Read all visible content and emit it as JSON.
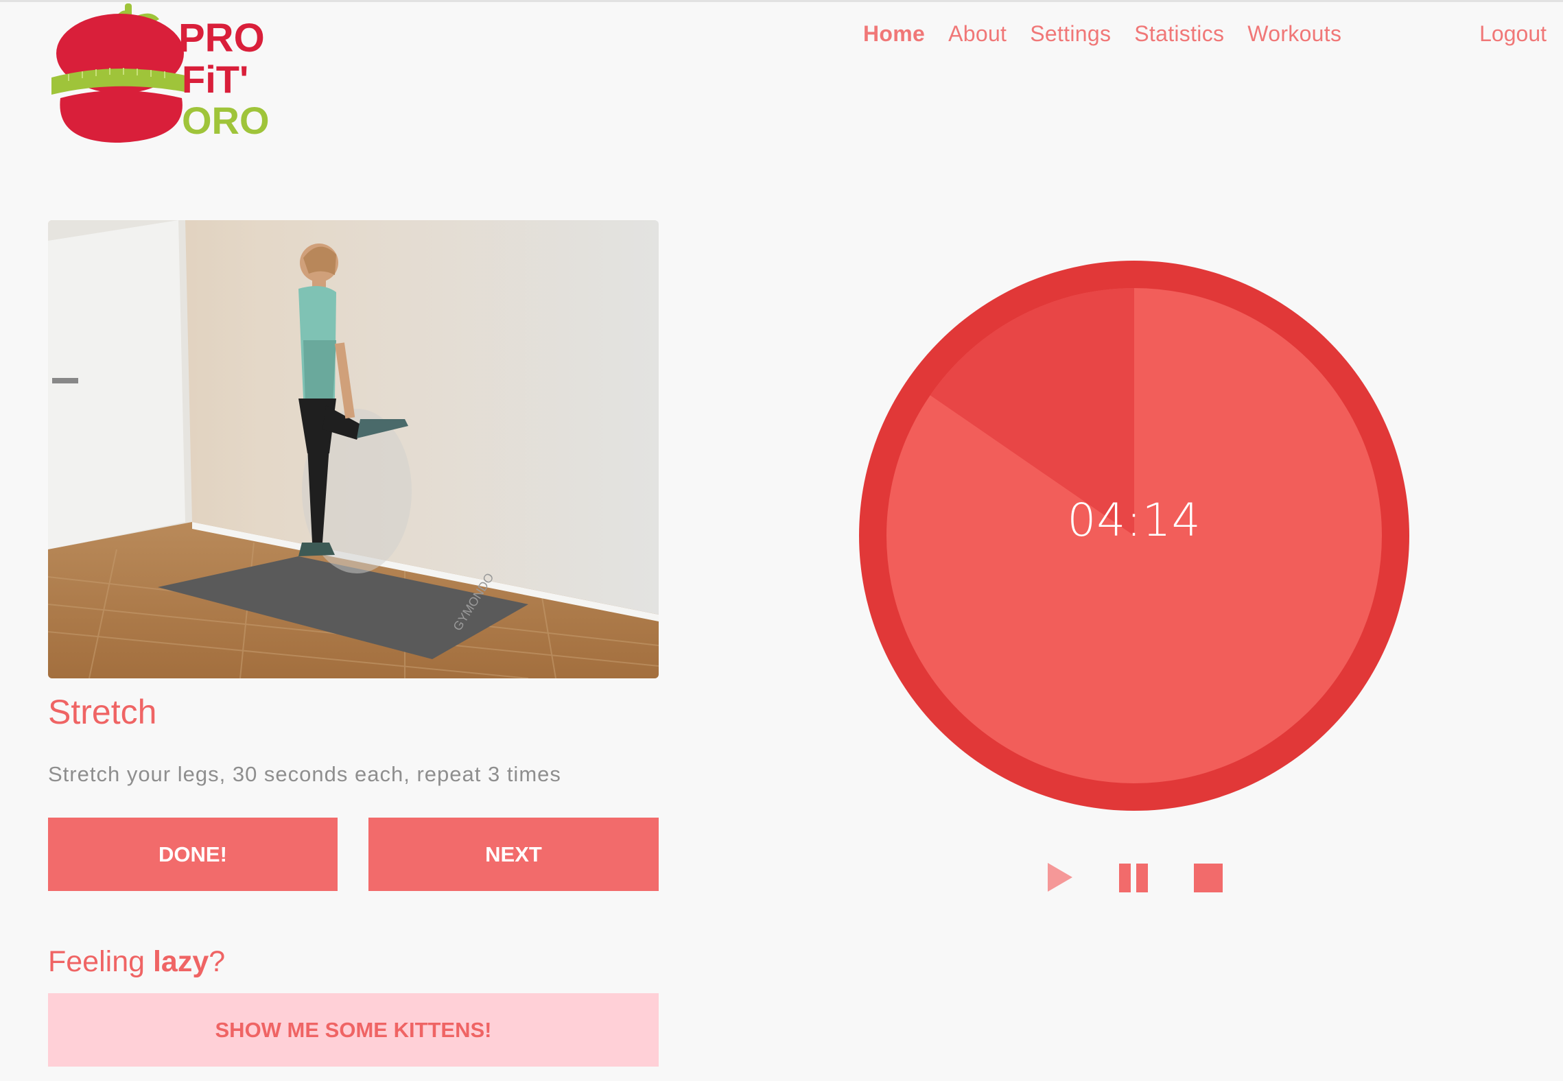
{
  "brand": {
    "logo_lines": [
      "PRO",
      "FiT'",
      "ORO"
    ],
    "colors": {
      "red": "#d91f3a",
      "green": "#9fc43a"
    }
  },
  "nav": {
    "items": [
      {
        "label": "Home",
        "active": true
      },
      {
        "label": "About",
        "active": false
      },
      {
        "label": "Settings",
        "active": false
      },
      {
        "label": "Statistics",
        "active": false
      },
      {
        "label": "Workouts",
        "active": false
      }
    ],
    "logout": "Logout"
  },
  "exercise": {
    "image_alt": "Woman doing a standing quad stretch against a wall on a yoga mat",
    "mat_text": "GYMONDO",
    "title": "Stretch",
    "description": "Stretch your legs, 30 seconds each, repeat 3 times"
  },
  "buttons": {
    "done": "DONE!",
    "next": "NEXT"
  },
  "lazy": {
    "prefix": "Feeling ",
    "emphasis": "lazy",
    "suffix": "?",
    "kittens_button": "SHOW ME SOME KITTENS!"
  },
  "timer": {
    "display": "04:14",
    "elapsed_fraction": 0.154,
    "colors": {
      "ring": "#e13838",
      "remaining": "#f25e5a",
      "elapsed": "#e84646"
    }
  },
  "controls": {
    "icons": [
      "play-icon",
      "pause-icon",
      "stop-icon"
    ],
    "colors": {
      "play": "#f59898",
      "pause": "#f26b6b",
      "stop": "#f26b6b"
    }
  },
  "colors": {
    "accent": "#f26b6b",
    "accent_text": "#ef6464",
    "muted_text": "#8e8e8e",
    "kitten_bg": "#ffd0d7",
    "background": "#f8f8f8"
  }
}
